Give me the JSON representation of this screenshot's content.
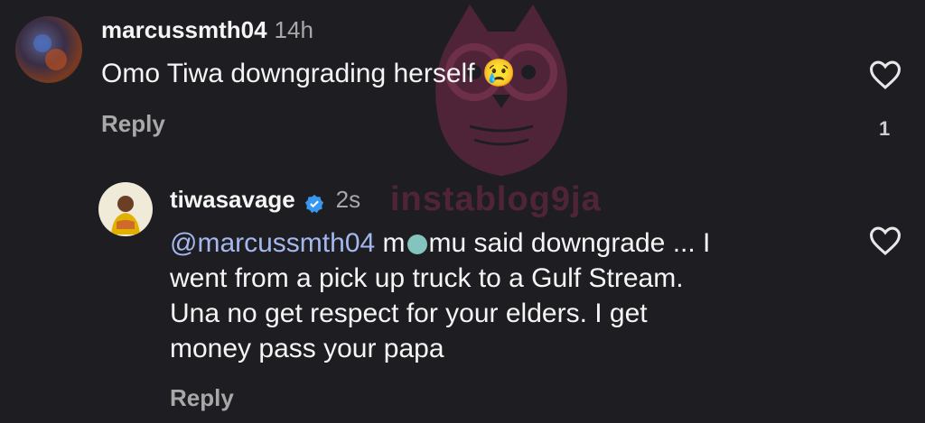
{
  "watermark": {
    "text": "instablog9ja"
  },
  "comment": {
    "username": "marcussmth04",
    "time": "14h",
    "text": "Omo Tiwa downgrading herself",
    "emoji": "😢",
    "reply_label": "Reply",
    "like_count": "1"
  },
  "reply": {
    "username": "tiwasavage",
    "time": "2s",
    "mention": "@marcussmth04",
    "text_part1": "m",
    "text_part2": "mu said downgrade ... I",
    "line2": "went from a pick up truck to a Gulf Stream.",
    "line3": "Una no get respect for your elders. I get",
    "line4": "money pass your papa",
    "reply_label": "Reply"
  },
  "colors": {
    "background": "#1e1e22",
    "mention": "#a4b8ef",
    "verified": "#3897f0",
    "watermark": "#7a2a4a"
  }
}
